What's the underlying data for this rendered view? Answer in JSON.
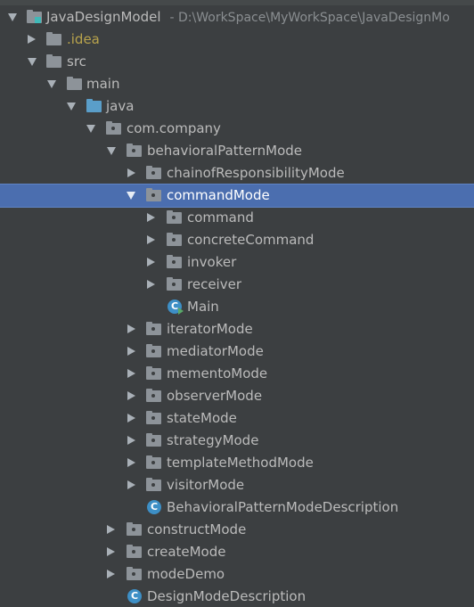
{
  "tree": {
    "root": {
      "label": "JavaDesignModel",
      "path": "- D:\\WorkSpace\\MyWorkSpace\\JavaDesignMo"
    },
    "nodes": [
      {
        "label": ".idea"
      },
      {
        "label": "src"
      },
      {
        "label": "main"
      },
      {
        "label": "java"
      },
      {
        "label": "com.company"
      },
      {
        "label": "behavioralPatternMode"
      },
      {
        "label": "chainofResponsibilityMode"
      },
      {
        "label": "commandMode"
      },
      {
        "label": "command"
      },
      {
        "label": "concreteCommand"
      },
      {
        "label": "invoker"
      },
      {
        "label": "receiver"
      },
      {
        "label": "Main"
      },
      {
        "label": "iteratorMode"
      },
      {
        "label": "mediatorMode"
      },
      {
        "label": "mementoMode"
      },
      {
        "label": "observerMode"
      },
      {
        "label": "stateMode"
      },
      {
        "label": "strategyMode"
      },
      {
        "label": "templateMethodMode"
      },
      {
        "label": "visitorMode"
      },
      {
        "label": "BehavioralPatternModeDescription"
      },
      {
        "label": "constructMode"
      },
      {
        "label": "createMode"
      },
      {
        "label": "modeDemo"
      },
      {
        "label": "DesignModeDescription"
      }
    ],
    "selected": "commandMode"
  },
  "icons": {
    "class_letter": "C"
  },
  "colors": {
    "background": "#3c3f41",
    "selection": "#4b6eaf",
    "text": "#bbbbbb",
    "class_icon": "#3d8fc6",
    "source_folder": "#5a9ec9"
  }
}
